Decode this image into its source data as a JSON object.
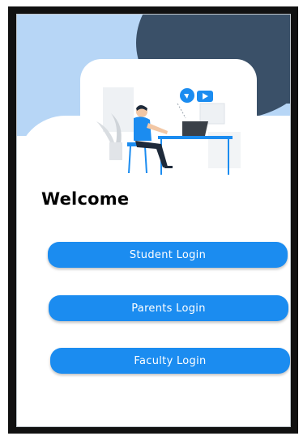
{
  "welcome": {
    "title": "Welcome"
  },
  "buttons": {
    "student": "Student Login",
    "parents": "Parents Login",
    "faculty": "Faculty Login"
  },
  "colors": {
    "accent": "#1b8cf0",
    "header_light": "#b7d6f6",
    "header_dark": "#3a5068"
  },
  "illustration": {
    "icon": "student-at-desk-illustration"
  }
}
